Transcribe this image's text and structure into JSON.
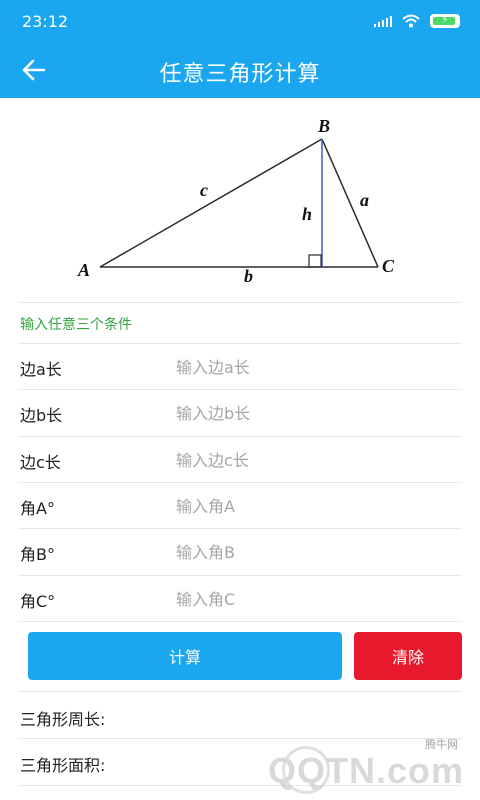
{
  "status": {
    "time": "23:12"
  },
  "header": {
    "title": "任意三角形计算"
  },
  "diagram": {
    "vertex_a": "A",
    "vertex_b": "B",
    "vertex_c": "C",
    "side_a": "a",
    "side_b": "b",
    "side_c": "c",
    "height": "h"
  },
  "form": {
    "hint": "输入任意三个条件",
    "fields": [
      {
        "label": "边a长",
        "placeholder": "输入边a长"
      },
      {
        "label": "边b长",
        "placeholder": "输入边b长"
      },
      {
        "label": "边c长",
        "placeholder": "输入边c长"
      },
      {
        "label": "角A°",
        "placeholder": "输入角A"
      },
      {
        "label": "角B°",
        "placeholder": "输入角B"
      },
      {
        "label": "角C°",
        "placeholder": "输入角C"
      }
    ]
  },
  "actions": {
    "calc_label": "计算",
    "clear_label": "清除"
  },
  "results": {
    "perimeter_label": "三角形周长:",
    "area_label": "三角形面积:"
  },
  "watermark": {
    "small": "腾牛网",
    "big": "QQTN.com"
  },
  "colors": {
    "primary": "#1aa7ef",
    "danger": "#e8192c",
    "hint": "#33a343"
  }
}
